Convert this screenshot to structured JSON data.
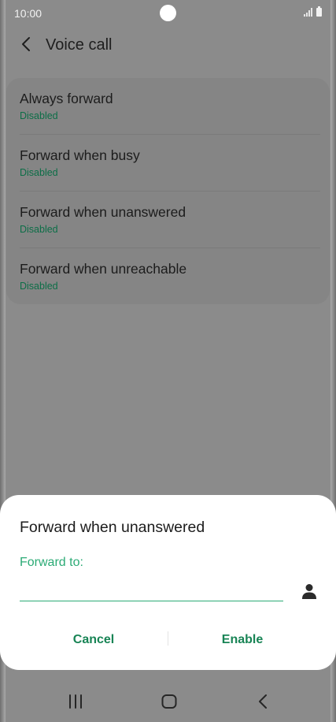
{
  "status_bar": {
    "time": "10:00"
  },
  "app_bar": {
    "title": "Voice call"
  },
  "settings": {
    "items": [
      {
        "title": "Always forward",
        "status": "Disabled"
      },
      {
        "title": "Forward when busy",
        "status": "Disabled"
      },
      {
        "title": "Forward when unanswered",
        "status": "Disabled"
      },
      {
        "title": "Forward when unreachable",
        "status": "Disabled"
      }
    ]
  },
  "dialog": {
    "title": "Forward when unanswered",
    "field_label": "Forward to:",
    "field_value": "",
    "cancel_label": "Cancel",
    "enable_label": "Enable"
  },
  "colors": {
    "accent_green": "#2cab76",
    "button_green": "#188455",
    "status_green": "#0c6e47",
    "dim_background": "#8b8b8b"
  },
  "icons": {
    "back": "chevron-left-icon",
    "contact": "person-icon",
    "nav_recents": "recents-icon",
    "nav_home": "home-icon",
    "nav_back": "back-icon"
  }
}
